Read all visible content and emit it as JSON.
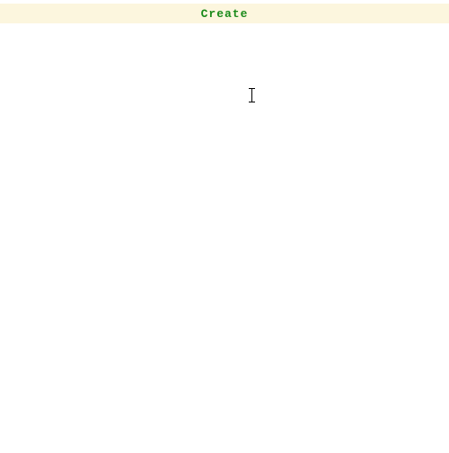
{
  "header": {
    "title": "Create"
  }
}
